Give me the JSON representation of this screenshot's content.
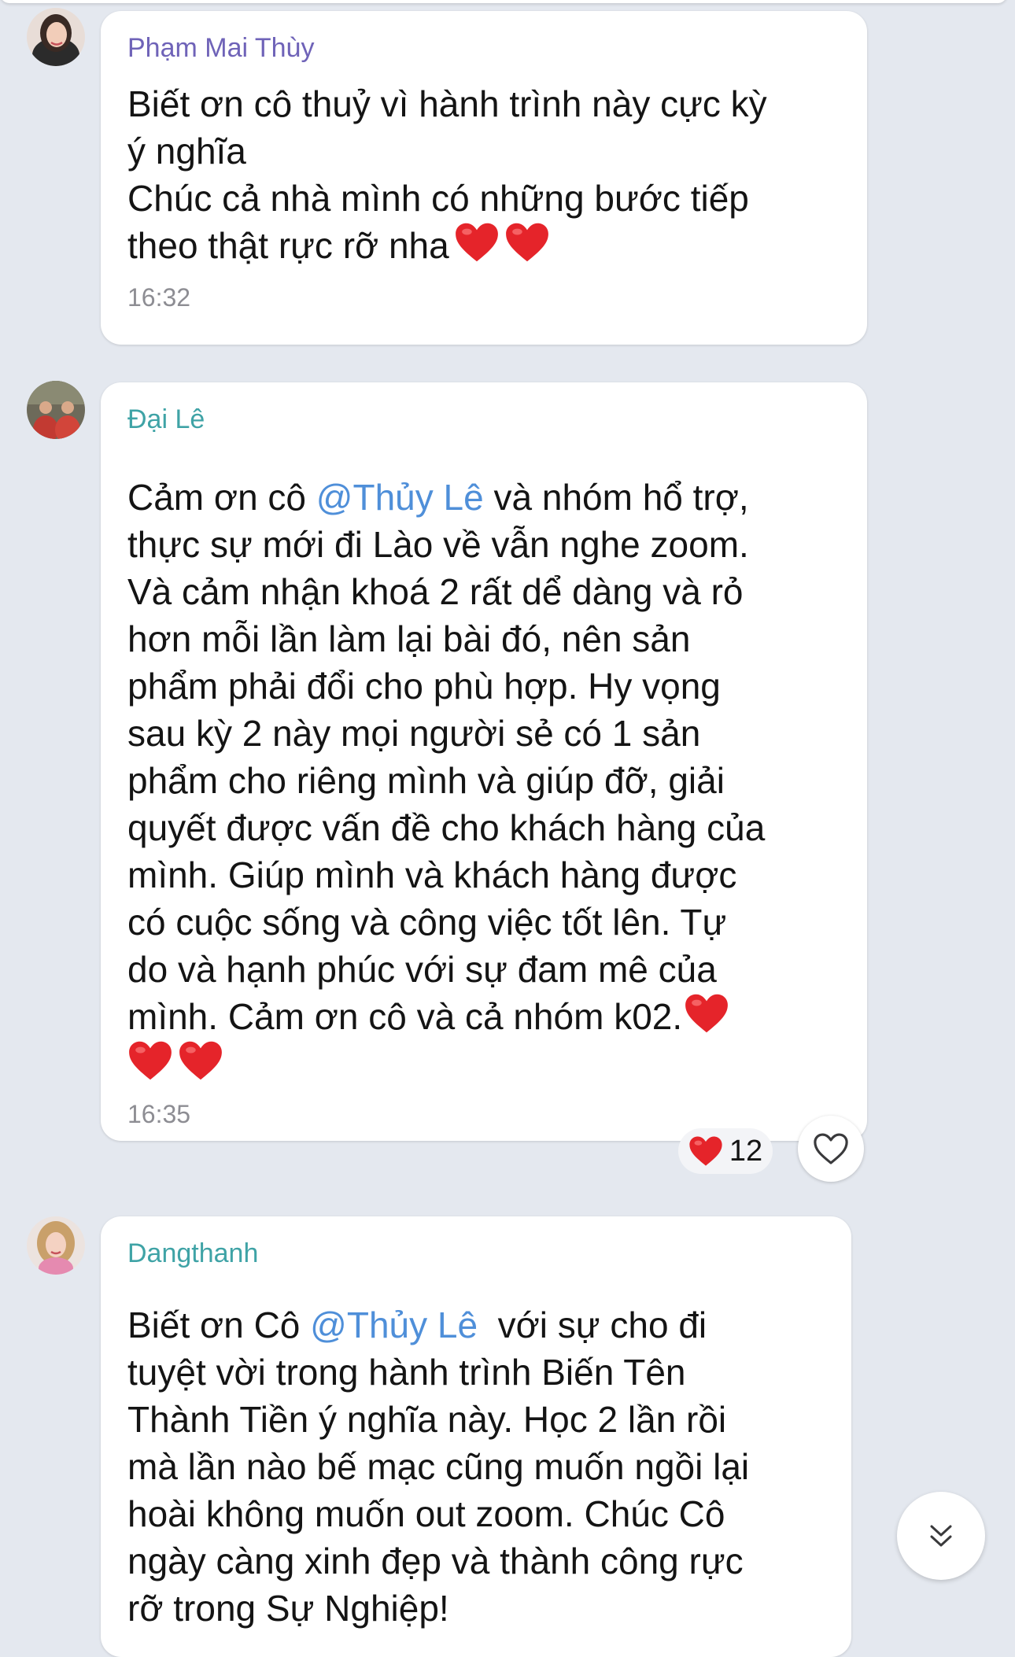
{
  "colors": {
    "background": "#e4e8ef",
    "bubble": "#ffffff",
    "mention": "#4f8fd9",
    "sender_1": "#6f63b8",
    "sender_2": "#3fa3a6",
    "sender_3": "#3fa3a6",
    "heart": "#e5242a"
  },
  "messages": [
    {
      "sender": "Phạm Mai Thùy",
      "lines": [
        [
          {
            "t": "Biết ơn cô thuỷ vì hành trình này cực kỳ"
          }
        ],
        [
          {
            "t": "ý nghĩa"
          }
        ],
        [
          {
            "t": "Chúc cả nhà mình có những bước tiếp"
          }
        ],
        [
          {
            "t": "theo thật rực rỡ nha"
          }
        ]
      ],
      "time": "16:32"
    },
    {
      "sender": "Đại Lê",
      "lines": [
        [
          {
            "t": "Cảm ơn cô "
          },
          {
            "t": "@Thủy Lê",
            "m": true
          },
          {
            "t": " và nhóm hổ trợ,"
          }
        ],
        [
          {
            "t": "thực sự mới đi Lào về vẫn nghe zoom."
          }
        ],
        [
          {
            "t": "Và cảm nhận khoá 2 rất dể dàng và rỏ"
          }
        ],
        [
          {
            "t": "hơn mỗi lần làm lại bài đó, nên sản"
          }
        ],
        [
          {
            "t": "phẩm phải đổi cho phù hợp. Hy vọng"
          }
        ],
        [
          {
            "t": "sau kỳ 2 này mọi người sẻ có 1 sản"
          }
        ],
        [
          {
            "t": "phẩm cho riêng mình và giúp đỡ, giải"
          }
        ],
        [
          {
            "t": "quyết được vấn đề cho khách hàng của"
          }
        ],
        [
          {
            "t": "mình. Giúp mình và khách hàng được"
          }
        ],
        [
          {
            "t": "có cuộc sống và công việc tốt lên. Tự"
          }
        ],
        [
          {
            "t": "do và hạnh phúc với sự đam mê của"
          }
        ],
        [
          {
            "t": "mình. Cảm ơn cô và cả nhóm k02."
          }
        ]
      ],
      "time": "16:35",
      "reaction": {
        "emoji": "heart",
        "count": "12"
      }
    },
    {
      "sender": "Dangthanh",
      "lines": [
        [
          {
            "t": "Biết ơn Cô "
          },
          {
            "t": "@Thủy Lê",
            "m": true
          },
          {
            "t": "  với sự cho đi"
          }
        ],
        [
          {
            "t": "tuyệt vời trong hành trình Biến Tên"
          }
        ],
        [
          {
            "t": "Thành Tiền ý nghĩa này. Học 2 lần rồi"
          }
        ],
        [
          {
            "t": "mà lần nào bế mạc cũng muốn ngồi lại"
          }
        ],
        [
          {
            "t": "hoài không muốn out zoom. Chúc Cô"
          }
        ],
        [
          {
            "t": "ngày càng xinh đẹp và thành công rực"
          }
        ],
        [
          {
            "t": "rỡ trong Sự Nghiệp!"
          }
        ]
      ]
    }
  ],
  "icons": {
    "reaction": "red-heart-icon",
    "like": "heart-outline-icon",
    "scroll": "double-chevron-down-icon"
  }
}
